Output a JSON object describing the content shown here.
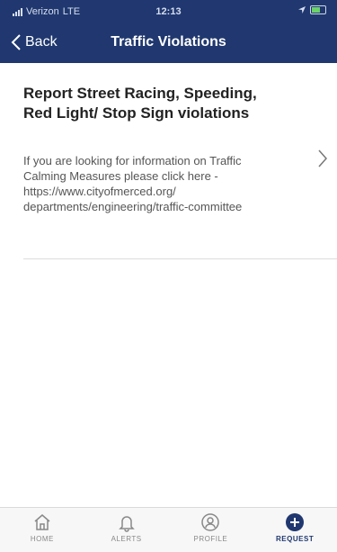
{
  "status_bar": {
    "carrier": "Verizon",
    "network": "LTE",
    "time": "12:13"
  },
  "nav": {
    "back_label": "Back",
    "title": "Traffic Violations"
  },
  "list": {
    "items": [
      {
        "title": "Report Street Racing, Speeding, Red Light/ Stop Sign violations",
        "description": "If you are looking for information on Traffic Calming Measures please click here - https://www.cityofmerced.org/ departments/engineering/traffic-committee"
      }
    ]
  },
  "tabs": [
    {
      "label": "HOME",
      "icon": "home-icon"
    },
    {
      "label": "ALERTS",
      "icon": "bell-icon"
    },
    {
      "label": "PROFILE",
      "icon": "user-icon"
    },
    {
      "label": "REQUEST",
      "icon": "plus-circle-icon",
      "active": true
    }
  ],
  "colors": {
    "primary": "#20386f",
    "active_tab": "#20386f",
    "inactive_tab": "#888888"
  }
}
